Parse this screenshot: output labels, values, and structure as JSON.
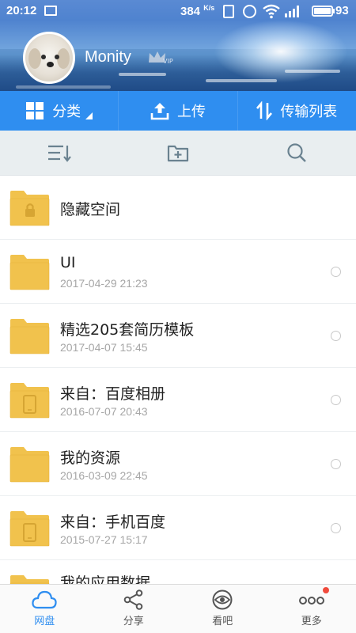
{
  "status_bar": {
    "time": "20:12",
    "speed": "384",
    "speed_unit": "K/s",
    "battery": "93"
  },
  "profile": {
    "username": "Monity",
    "badge": "VIP"
  },
  "toolbar": {
    "category_label": "分类",
    "upload_label": "上传",
    "transfer_label": "传输列表"
  },
  "actions": {
    "sort_icon": "sort-icon",
    "new_folder_icon": "new-folder-icon",
    "search_icon": "search-icon"
  },
  "files": [
    {
      "name": "隐藏空间",
      "date": "",
      "type": "locked-folder"
    },
    {
      "name": "UI",
      "date": "2017-04-29  21:23",
      "type": "folder"
    },
    {
      "name": "精选205套简历模板",
      "date": "2017-04-07  15:45",
      "type": "folder"
    },
    {
      "name": "来自：百度相册",
      "date": "2016-07-07  20:43",
      "type": "phone-folder"
    },
    {
      "name": "我的资源",
      "date": "2016-03-09  22:45",
      "type": "folder"
    },
    {
      "name": "来自：手机百度",
      "date": "2015-07-27  15:17",
      "type": "phone-folder"
    },
    {
      "name": "我的应用数据",
      "date": "",
      "type": "folder"
    }
  ],
  "bottom_nav": [
    {
      "label": "网盘",
      "icon": "cloud-icon",
      "active": true
    },
    {
      "label": "分享",
      "icon": "share-icon",
      "active": false
    },
    {
      "label": "看吧",
      "icon": "eye-icon",
      "active": false
    },
    {
      "label": "更多",
      "icon": "more-icon",
      "active": false,
      "dot": true
    }
  ],
  "colors": {
    "accent": "#2f8ef0",
    "folder": "#f1c24d",
    "action_bar": "#e9eef0",
    "dot": "#f04a3c"
  }
}
